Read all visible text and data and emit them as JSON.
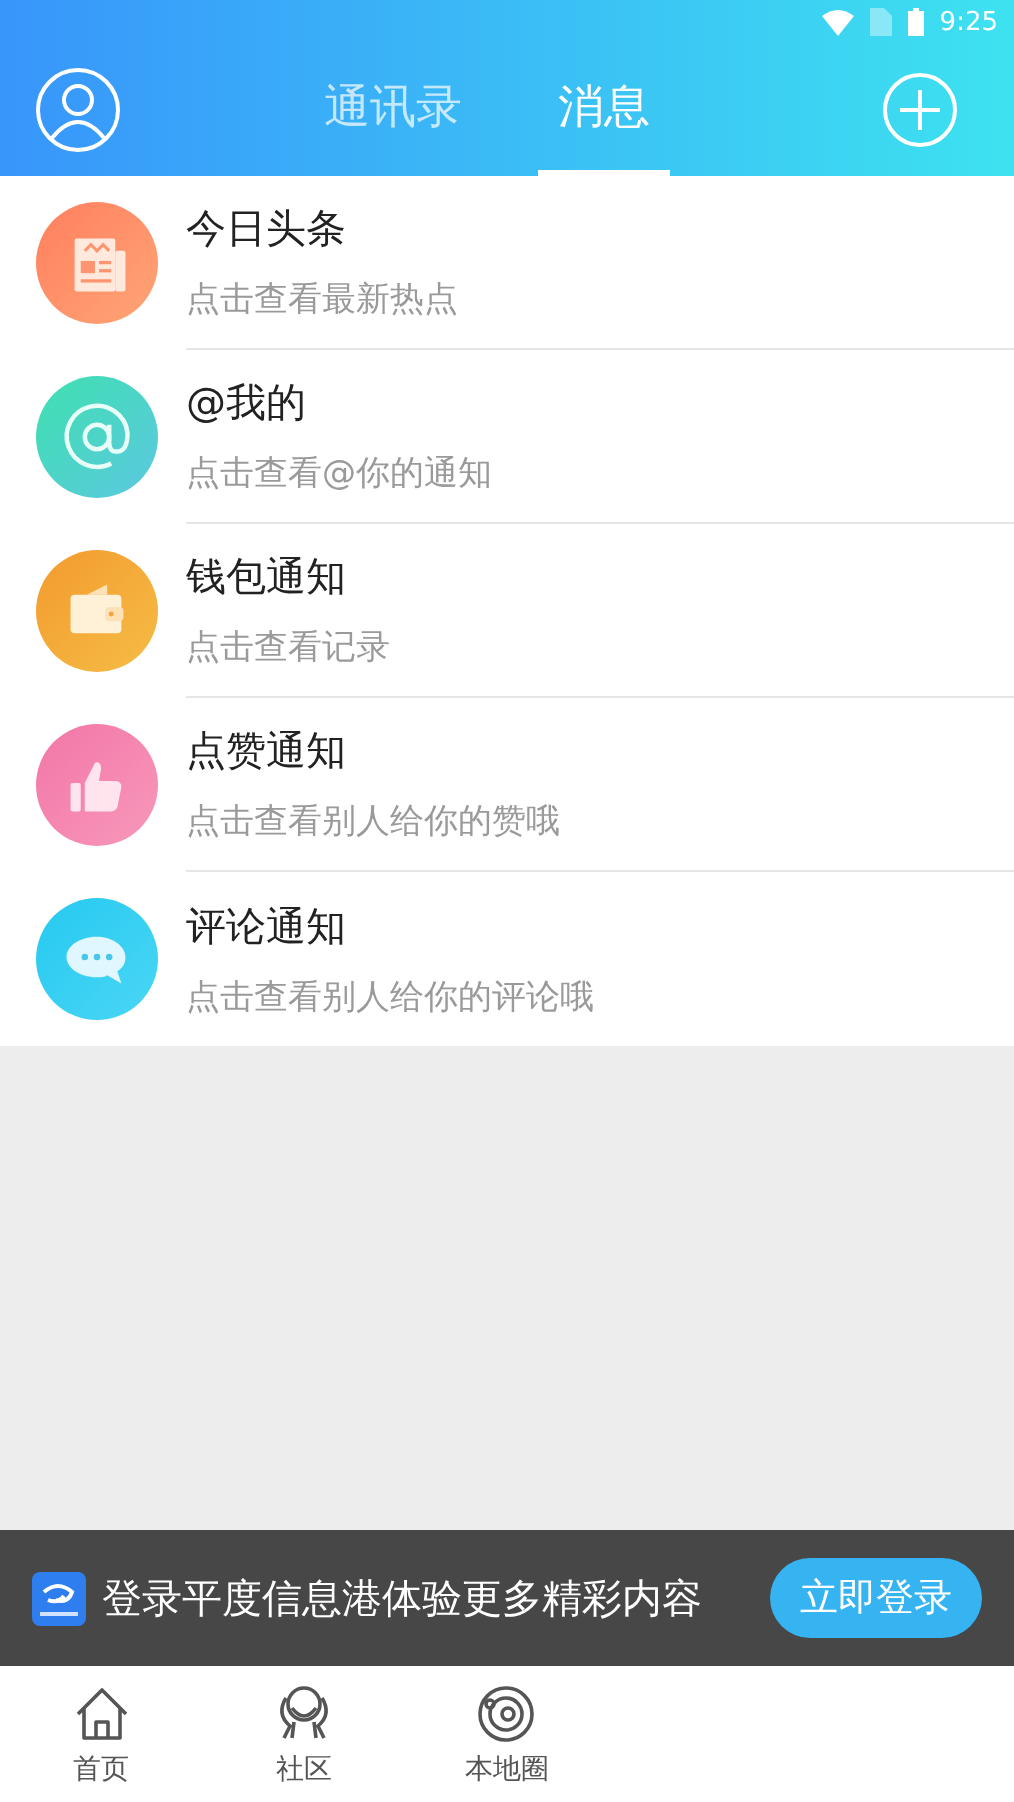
{
  "status_bar": {
    "time": "9:25"
  },
  "header": {
    "tabs": [
      {
        "label": "通讯录",
        "selected": false
      },
      {
        "label": "消息",
        "selected": true
      }
    ]
  },
  "messages": [
    {
      "kind": "news",
      "title": "今日头条",
      "subtitle": "点击查看最新热点"
    },
    {
      "kind": "mention",
      "title": "@我的",
      "subtitle": "点击查看@你的通知"
    },
    {
      "kind": "wallet",
      "title": "钱包通知",
      "subtitle": "点击查看记录"
    },
    {
      "kind": "like",
      "title": "点赞通知",
      "subtitle": "点击查看别人给你的赞哦"
    },
    {
      "kind": "comment",
      "title": "评论通知",
      "subtitle": "点击查看别人给你的评论哦"
    }
  ],
  "login_banner": {
    "text": "登录平度信息港体验更多精彩内容",
    "button": "立即登录"
  },
  "bottom_nav": [
    {
      "kind": "home",
      "label": "首页",
      "selected": false
    },
    {
      "kind": "community",
      "label": "社区",
      "selected": false
    },
    {
      "kind": "local",
      "label": "本地圈",
      "selected": false
    }
  ]
}
